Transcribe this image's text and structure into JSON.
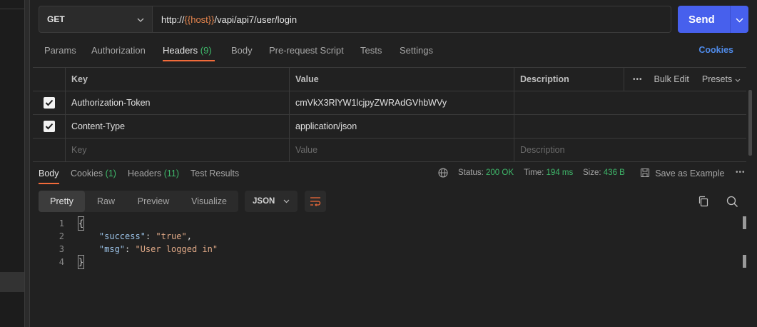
{
  "request": {
    "method": "GET",
    "url_prefix": "http://",
    "url_variable": "{{host}}",
    "url_suffix": "/vapi/api7/user/login",
    "send_label": "Send"
  },
  "request_tabs": [
    {
      "label": "Params",
      "count": ""
    },
    {
      "label": "Authorization",
      "count": ""
    },
    {
      "label": "Headers",
      "count": "(9)"
    },
    {
      "label": "Body",
      "count": ""
    },
    {
      "label": "Pre-request Script",
      "count": ""
    },
    {
      "label": "Tests",
      "count": ""
    },
    {
      "label": "Settings",
      "count": ""
    }
  ],
  "cookies_link": "Cookies",
  "headers_table": {
    "columns": {
      "key": "Key",
      "value": "Value",
      "description": "Description"
    },
    "actions": {
      "more": "•••",
      "bulk_edit": "Bulk Edit",
      "presets": "Presets"
    },
    "rows": [
      {
        "checked": true,
        "key": "Authorization-Token",
        "value": "cmVkX3RlYW1lcjpyZWRAdGVhbWVy",
        "description": ""
      },
      {
        "checked": true,
        "key": "Content-Type",
        "value": "application/json",
        "description": ""
      }
    ],
    "placeholder": {
      "key": "Key",
      "value": "Value",
      "description": "Description"
    }
  },
  "response_tabs": [
    {
      "label": "Body",
      "count": ""
    },
    {
      "label": "Cookies",
      "count": "(1)"
    },
    {
      "label": "Headers",
      "count": "(11)"
    },
    {
      "label": "Test Results",
      "count": ""
    }
  ],
  "response_meta": {
    "status_label": "Status:",
    "status_value": "200 OK",
    "time_label": "Time:",
    "time_value": "194 ms",
    "size_label": "Size:",
    "size_value": "436 B",
    "save_label": "Save as Example",
    "more": "•••"
  },
  "view_modes": [
    "Pretty",
    "Raw",
    "Preview",
    "Visualize"
  ],
  "format": "JSON",
  "code_lines": [
    {
      "n": "1",
      "text": "{"
    },
    {
      "n": "2",
      "key": "\"success\"",
      "value": "\"true\"",
      "trail": ","
    },
    {
      "n": "3",
      "key": "\"msg\"",
      "value": "\"User logged in\"",
      "trail": ""
    },
    {
      "n": "4",
      "text": "}"
    }
  ],
  "colors": {
    "accent": "#f26b3a",
    "send": "#4760ed",
    "success": "#3fb96b",
    "link": "#4f8ae8",
    "variable": "#e8864e"
  }
}
